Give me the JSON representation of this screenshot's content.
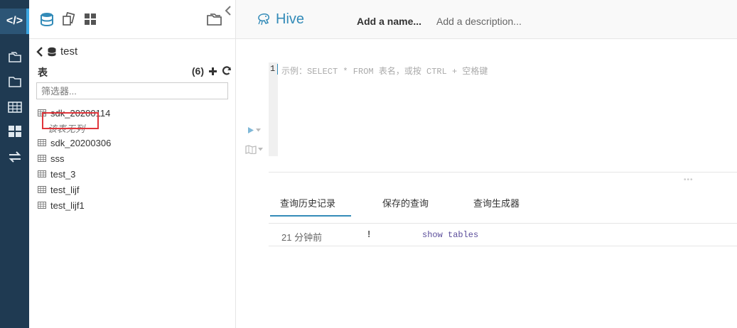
{
  "sidebar_nav": {
    "items": [
      {
        "icon": "code-icon",
        "active": true
      },
      {
        "icon": "documents-icon"
      },
      {
        "icon": "folder-icon"
      },
      {
        "icon": "table-icon"
      },
      {
        "icon": "dashboard-icon"
      },
      {
        "icon": "swap-icon"
      }
    ],
    "colors": {
      "background": "#1f3a52",
      "active_bg": "#2c5576",
      "active_bar": "#3ba5e0"
    }
  },
  "assist_panel": {
    "database": "test",
    "tables_title": "表",
    "tables_count": "(6)",
    "filter_placeholder": "筛选器...",
    "tables": [
      {
        "name": "sdk_20200114",
        "note": "该表无列"
      },
      {
        "name": "sdk_20200306"
      },
      {
        "name": "sss"
      },
      {
        "name": "test_3"
      },
      {
        "name": "test_lijf"
      },
      {
        "name": "test_lijf1"
      }
    ]
  },
  "editor_header": {
    "engine": "Hive",
    "add_name": "Add a name...",
    "add_description": "Add a description..."
  },
  "editor": {
    "line_number": "1",
    "placeholder": "示例：SELECT * FROM 表名，或按 CTRL + 空格键"
  },
  "results": {
    "tabs": [
      "查询历史记录",
      "保存的查询",
      "查询生成器"
    ],
    "active_tab": 0,
    "history": [
      {
        "time": "21 分钟前",
        "status": "!",
        "query": "show tables"
      }
    ]
  },
  "colors": {
    "accent": "#338bb8",
    "highlight_box": "#e0353b"
  }
}
